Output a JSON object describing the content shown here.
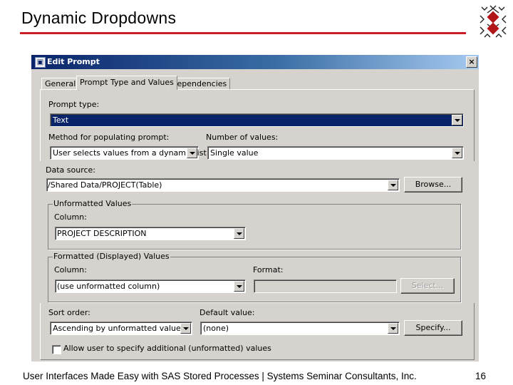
{
  "slide": {
    "title": "Dynamic Dropdowns",
    "footer": "User Interfaces Made Easy with SAS Stored Processes  |  Systems Seminar Consultants, Inc.",
    "page_number": "16",
    "accent_color": "#cc1f25"
  },
  "dialog": {
    "title": "Edit Prompt",
    "close": "×",
    "tabs": [
      "General",
      "Prompt Type and Values",
      "Dependencies"
    ],
    "active_tab": "Prompt Type and Values",
    "prompt_type": {
      "label": "Prompt type:",
      "value": "Text"
    },
    "method": {
      "label": "Method for populating prompt:",
      "value": "User selects values from a dynamic list"
    },
    "number_of_values": {
      "label": "Number of values:",
      "value": "Single value"
    },
    "data_source": {
      "label": "Data source:",
      "value": "/Shared Data/PROJECT(Table)",
      "browse_label": "Browse..."
    },
    "unformatted": {
      "group_label": "Unformatted Values",
      "column_label": "Column:",
      "column_value": "PROJECT DESCRIPTION"
    },
    "formatted": {
      "group_label": "Formatted (Displayed) Values",
      "column_label": "Column:",
      "column_value": "(use unformatted column)",
      "format_label": "Format:",
      "format_value": "",
      "select_label": "Select..."
    },
    "sort_order": {
      "label": "Sort order:",
      "value": "Ascending by unformatted value"
    },
    "default_value": {
      "label": "Default value:",
      "value": "(none)",
      "specify_label": "Specify..."
    },
    "allow_additional": {
      "label": "Allow user to specify additional (unformatted) values",
      "checked": false
    }
  }
}
